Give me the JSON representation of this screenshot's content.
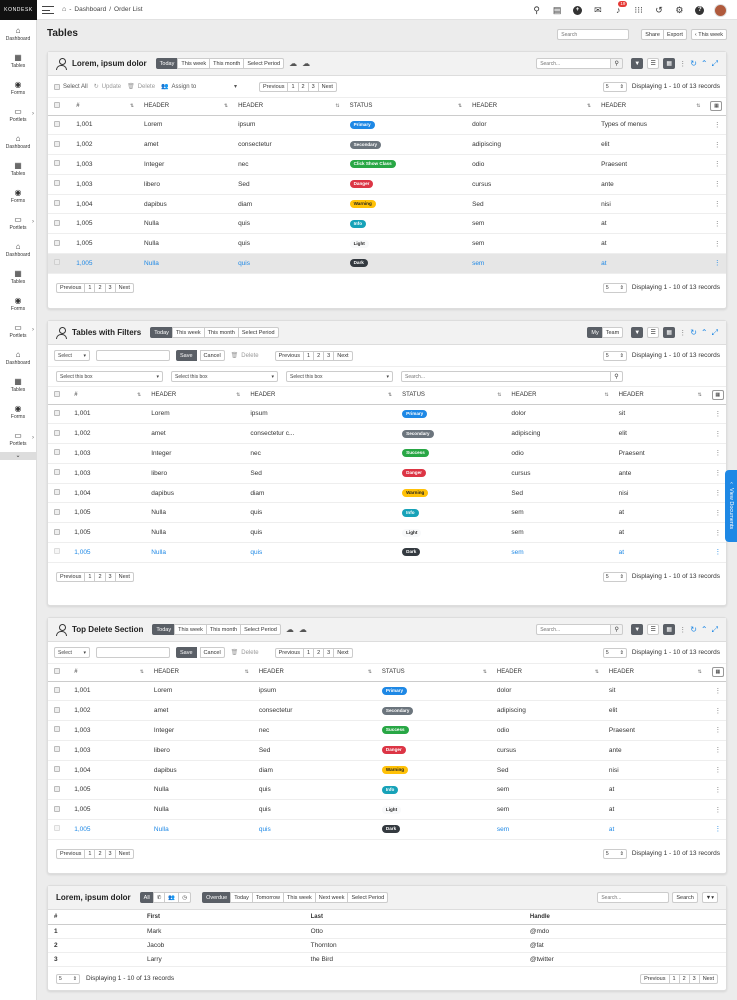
{
  "app": {
    "logo": "KONDESK"
  },
  "breadcrumb": {
    "items": [
      "Dashboard",
      "Order List"
    ],
    "sep": "/"
  },
  "topbar": {
    "notification_count": "19"
  },
  "sidebar": {
    "items": [
      {
        "label": "Dashboard",
        "icon": "home-icon",
        "glyph": "⌂",
        "chevron": false
      },
      {
        "label": "Tables",
        "icon": "table-icon",
        "glyph": "▦",
        "chevron": false
      },
      {
        "label": "Forms",
        "icon": "radio-icon",
        "glyph": "◉",
        "chevron": false
      },
      {
        "label": "Portlets",
        "icon": "window-icon",
        "glyph": "▭",
        "chevron": true
      }
    ]
  },
  "page": {
    "title": "Tables",
    "search_placeholder": "Search",
    "share": "Share",
    "export": "Export",
    "period": "This week"
  },
  "periods": [
    "Today",
    "This week",
    "This month",
    "Select Period"
  ],
  "card_search_placeholder": "Search...",
  "bulk": {
    "select_all": "Select All",
    "update": "Update",
    "delete": "Delete",
    "assign": "Assign to"
  },
  "pager": [
    "Previous",
    "1",
    "2",
    "3",
    "Next"
  ],
  "page_size": "5",
  "displaying": "Displaying 1 - 10 of 13 records",
  "form": {
    "select": "Select",
    "save": "Save",
    "cancel": "Cancel",
    "delete": "Delete",
    "filter_placeholder": "Select this box",
    "filter_search": "Search..."
  },
  "myteam": [
    "My",
    "Team"
  ],
  "headers": {
    "id": "#",
    "header": "HEADER",
    "status": "STATUS"
  },
  "card1": {
    "title": "Lorem, ipsum dolor",
    "rows": [
      [
        "1,001",
        "Lorem",
        "ipsum",
        "Primary",
        "dolor",
        "Types of menus"
      ],
      [
        "1,002",
        "amet",
        "consectetur",
        "Secondary",
        "adipiscing",
        "elit"
      ],
      [
        "1,003",
        "Integer",
        "nec",
        "Click Show Class",
        "odio",
        "Praesent"
      ],
      [
        "1,003",
        "libero",
        "Sed",
        "Danger",
        "cursus",
        "ante"
      ],
      [
        "1,004",
        "dapibus",
        "diam",
        "Warning",
        "Sed",
        "nisi"
      ],
      [
        "1,005",
        "Nulla",
        "quis",
        "Info",
        "sem",
        "at"
      ],
      [
        "1,005",
        "Nulla",
        "quis",
        "Light",
        "sem",
        "at"
      ],
      [
        "1,005",
        "Nulla",
        "quis",
        "Dark",
        "sem",
        "at"
      ]
    ]
  },
  "card2": {
    "title": "Tables with Filters",
    "rows": [
      [
        "1,001",
        "Lorem",
        "ipsum",
        "Primary",
        "dolor",
        "sit"
      ],
      [
        "1,002",
        "amet",
        "consectetur c...",
        "Secondary",
        "adipiscing",
        "elit"
      ],
      [
        "1,003",
        "Integer",
        "nec",
        "Success",
        "odio",
        "Praesent"
      ],
      [
        "1,003",
        "libero",
        "Sed",
        "Danger",
        "cursus",
        "ante"
      ],
      [
        "1,004",
        "dapibus",
        "diam",
        "Warning",
        "Sed",
        "nisi"
      ],
      [
        "1,005",
        "Nulla",
        "quis",
        "Info",
        "sem",
        "at"
      ],
      [
        "1,005",
        "Nulla",
        "quis",
        "Light",
        "sem",
        "at"
      ],
      [
        "1,005",
        "Nulla",
        "quis",
        "Dark",
        "sem",
        "at"
      ]
    ]
  },
  "card3": {
    "title": "Top Delete Section",
    "rows": [
      [
        "1,001",
        "Lorem",
        "ipsum",
        "Primary",
        "dolor",
        "sit"
      ],
      [
        "1,002",
        "amet",
        "consectetur",
        "Secondary",
        "adipiscing",
        "elit"
      ],
      [
        "1,003",
        "Integer",
        "nec",
        "Success",
        "odio",
        "Praesent"
      ],
      [
        "1,003",
        "libero",
        "Sed",
        "Danger",
        "cursus",
        "ante"
      ],
      [
        "1,004",
        "dapibus",
        "diam",
        "Warning",
        "Sed",
        "nisi"
      ],
      [
        "1,005",
        "Nulla",
        "quis",
        "Info",
        "sem",
        "at"
      ],
      [
        "1,005",
        "Nulla",
        "quis",
        "Light",
        "sem",
        "at"
      ],
      [
        "1,005",
        "Nulla",
        "quis",
        "Dark",
        "sem",
        "at"
      ]
    ]
  },
  "card4": {
    "title": "Lorem, ipsum dolor",
    "all": "All",
    "periods": [
      "Overdue",
      "Today",
      "Tomorrow",
      "This week",
      "Next week",
      "Select Period"
    ],
    "search_placeholder": "Search...",
    "search_btn": "Search",
    "headers": [
      "#",
      "First",
      "Last",
      "Handle"
    ],
    "rows": [
      [
        "1",
        "Mark",
        "Otto",
        "@mdo"
      ],
      [
        "2",
        "Jacob",
        "Thornton",
        "@fat"
      ],
      [
        "3",
        "Larry",
        "the Bird",
        "@twitter"
      ]
    ]
  },
  "view_documents": "View Documents",
  "status_colors": {
    "Primary": "#1e88e5",
    "Secondary": "#6c757d",
    "Click Show Class": "#28a745",
    "Success": "#28a745",
    "Danger": "#dc3545",
    "Warning": "#ffc107",
    "Info": "#17a2b8",
    "Light": "#f8f9fa",
    "Dark": "#343a40"
  }
}
